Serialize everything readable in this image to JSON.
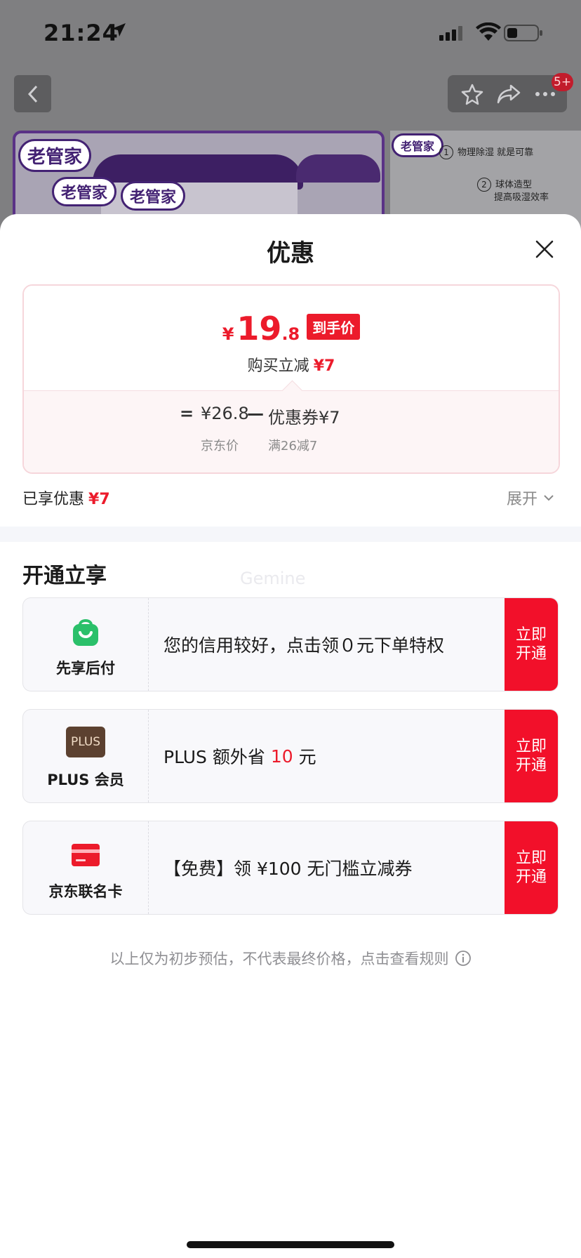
{
  "status_bar": {
    "time": "21:24"
  },
  "background_page": {
    "badge": "5+",
    "brand_logo": "老管家",
    "features": [
      {
        "num": "1",
        "text": "物理除湿 就是可靠"
      },
      {
        "num": "2",
        "text": "球体造型"
      },
      {
        "num": "",
        "text": "提高吸湿效率"
      }
    ]
  },
  "sheet": {
    "title": "优惠",
    "price": {
      "currency": "¥",
      "integer": "19",
      "decimal": ".8",
      "tag": "到手价",
      "reduce_label": "购买立减",
      "reduce_value": "¥7",
      "formula_eq": "=",
      "jd_price": "¥26.8",
      "minus": "—",
      "coupon": "优惠券¥7",
      "jd_price_label": "京东价",
      "coupon_rule": "满26减7"
    },
    "enjoyed_label": "已享优惠",
    "enjoyed_value": "¥7",
    "expand_label": "展开",
    "section_title": "开通立享",
    "watermark": "Gemine",
    "offers": [
      {
        "label": "先享后付",
        "icon": "shopping-bag-smile-icon",
        "text": "您的信用较好，点击领０元下单特权",
        "button": "立即开通"
      },
      {
        "label": "PLUS 会员",
        "icon": "plus-badge-icon",
        "icon_text": "PLUS",
        "text_pre": "PLUS 额外省 ",
        "text_hl": "10",
        "text_post": " 元",
        "button": "立即开通"
      },
      {
        "label": "京东联名卡",
        "icon": "credit-card-icon",
        "text": "【免费】领 ¥100 无门槛立减券",
        "button": "立即开通"
      }
    ],
    "disclaimer": "以上仅为初步预估，不代表最终价格，点击查看规则"
  },
  "colors": {
    "accent_red": "#ec1b2b",
    "button_red": "#f2102a",
    "plus_brown": "#5c4130",
    "pay_green": "#2bc06a"
  }
}
